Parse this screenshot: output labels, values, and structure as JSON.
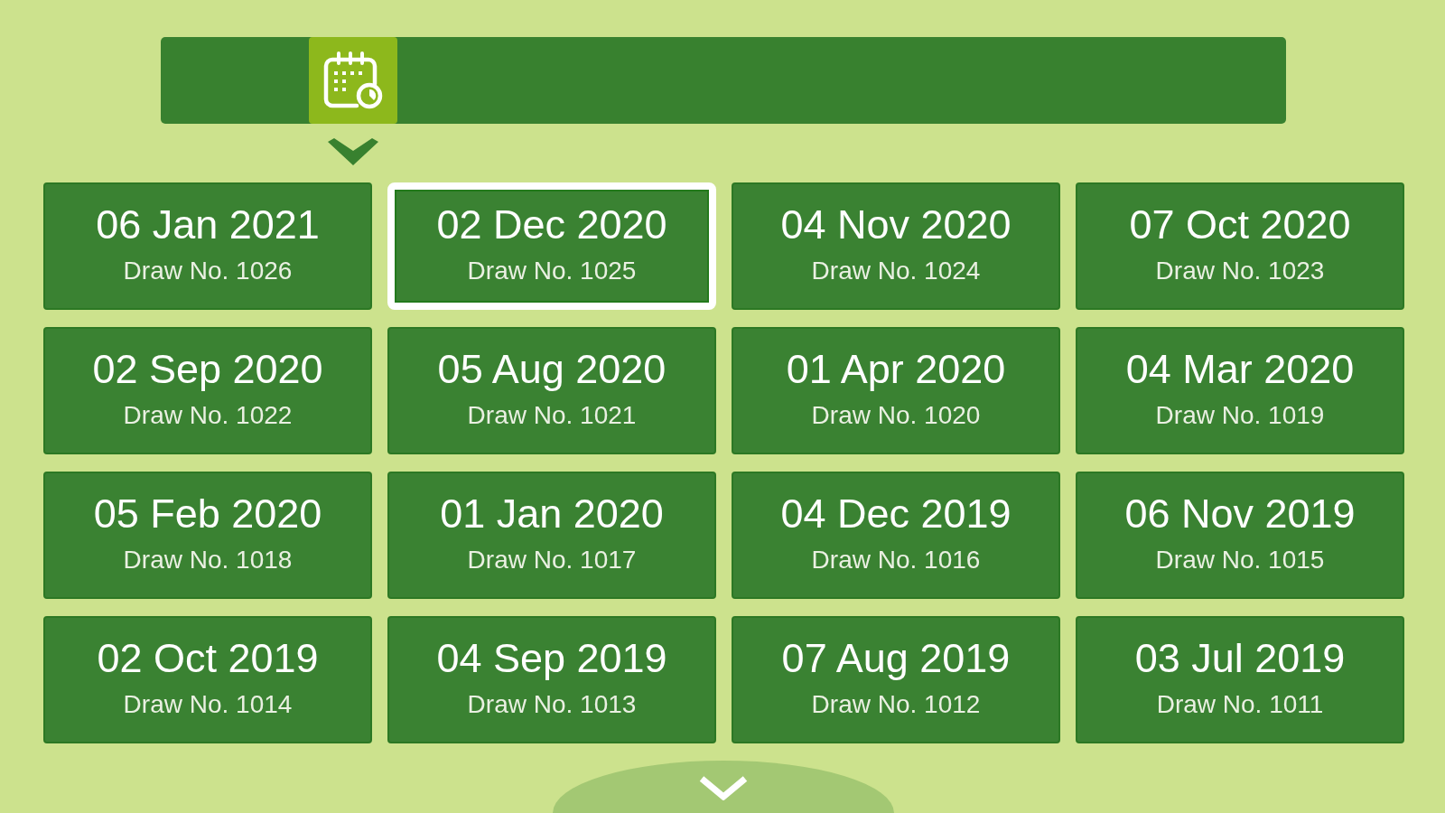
{
  "toolbar": {
    "tabs": [
      {
        "kind": "calendar",
        "selected": true
      }
    ]
  },
  "draws": [
    {
      "date": "06 Jan 2021",
      "draw_no": "Draw No. 1026",
      "selected": false
    },
    {
      "date": "02 Dec 2020",
      "draw_no": "Draw No. 1025",
      "selected": true
    },
    {
      "date": "04 Nov 2020",
      "draw_no": "Draw No. 1024",
      "selected": false
    },
    {
      "date": "07 Oct 2020",
      "draw_no": "Draw No. 1023",
      "selected": false
    },
    {
      "date": "02 Sep 2020",
      "draw_no": "Draw No. 1022",
      "selected": false
    },
    {
      "date": "05 Aug 2020",
      "draw_no": "Draw No. 1021",
      "selected": false
    },
    {
      "date": "01 Apr 2020",
      "draw_no": "Draw No. 1020",
      "selected": false
    },
    {
      "date": "04 Mar 2020",
      "draw_no": "Draw No. 1019",
      "selected": false
    },
    {
      "date": "05 Feb 2020",
      "draw_no": "Draw No. 1018",
      "selected": false
    },
    {
      "date": "01 Jan 2020",
      "draw_no": "Draw No. 1017",
      "selected": false
    },
    {
      "date": "04 Dec 2019",
      "draw_no": "Draw No. 1016",
      "selected": false
    },
    {
      "date": "06 Nov 2019",
      "draw_no": "Draw No. 1015",
      "selected": false
    },
    {
      "date": "02 Oct 2019",
      "draw_no": "Draw No. 1014",
      "selected": false
    },
    {
      "date": "04 Sep 2019",
      "draw_no": "Draw No. 1013",
      "selected": false
    },
    {
      "date": "07 Aug 2019",
      "draw_no": "Draw No. 1012",
      "selected": false
    },
    {
      "date": "03 Jul 2019",
      "draw_no": "Draw No. 1011",
      "selected": false
    }
  ]
}
